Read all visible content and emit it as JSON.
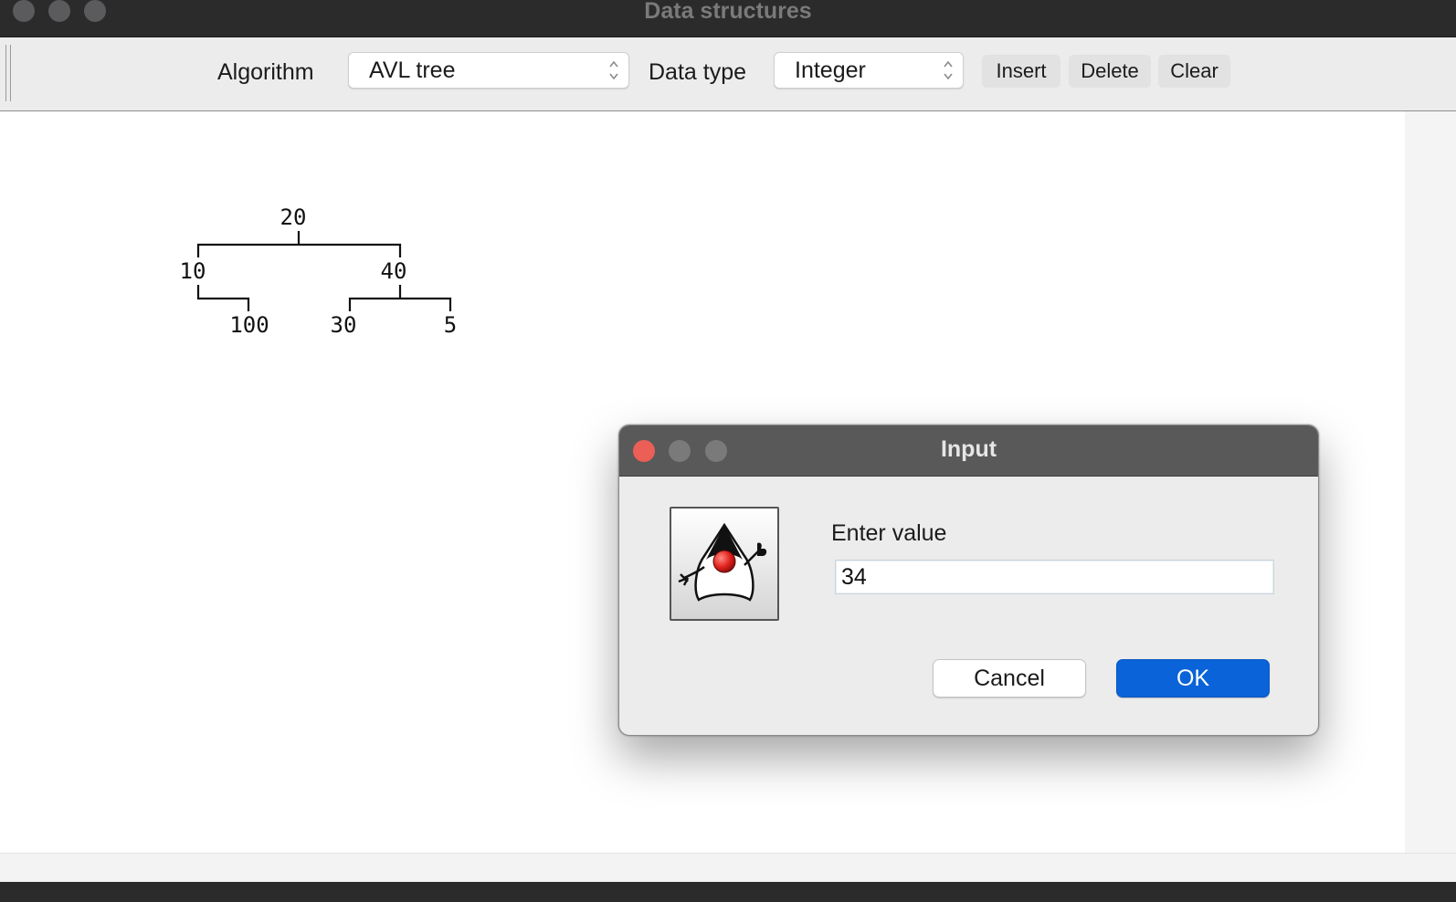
{
  "window": {
    "title": "Data structures"
  },
  "toolbar": {
    "algorithm_label": "Algorithm",
    "algorithm_value": "AVL tree",
    "data_type_label": "Data type",
    "data_type_value": "Integer",
    "insert_label": "Insert",
    "delete_label": "Delete",
    "clear_label": "Clear"
  },
  "tree": {
    "nodes": {
      "root": "20",
      "left": "10",
      "left_right": "100",
      "right": "40",
      "right_left": "30",
      "right_right": "5"
    }
  },
  "dialog": {
    "title": "Input",
    "icon": "duke-icon",
    "prompt": "Enter value",
    "input_value": "34",
    "cancel_label": "Cancel",
    "ok_label": "OK"
  },
  "colors": {
    "title_bar": "#2b2b2c",
    "toolbar_bg": "#ececec",
    "dialog_title_bar": "#595959",
    "ok_button": "#0a63d8",
    "close_traffic_light": "#ec5f57"
  }
}
